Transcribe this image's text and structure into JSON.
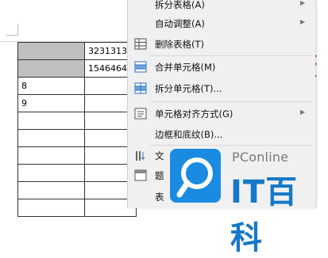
{
  "document": {
    "table_rows": [
      [
        "",
        "3231313"
      ],
      [
        "",
        "1546464"
      ],
      [
        "8",
        ""
      ],
      [
        "9",
        ""
      ],
      [
        "",
        ""
      ],
      [
        "",
        ""
      ],
      [
        "",
        ""
      ],
      [
        "",
        ""
      ],
      [
        "",
        ""
      ],
      [
        "",
        ""
      ]
    ]
  },
  "context_menu": {
    "items": [
      {
        "label": "拆分表格(A)",
        "icon": "none",
        "has_submenu": true
      },
      {
        "label": "自动调整(A)",
        "icon": "none",
        "has_submenu": true
      },
      {
        "label": "删除表格(T)",
        "icon": "delete-table-icon",
        "has_submenu": false
      },
      {
        "label": "合并单元格(M)",
        "icon": "merge-cells-icon",
        "has_submenu": false
      },
      {
        "label": "拆分单元格(T)...",
        "icon": "split-cells-icon",
        "has_submenu": false
      },
      {
        "label": "单元格对齐方式(G)",
        "icon": "cell-align-icon",
        "has_submenu": true
      },
      {
        "label": "边框和底纹(B)...",
        "icon": "none",
        "has_submenu": false
      },
      {
        "label": "文",
        "icon": "text-direction-icon",
        "has_submenu": false
      },
      {
        "label": "题",
        "icon": "title-row-icon",
        "has_submenu": false
      },
      {
        "label": "表",
        "icon": "table-properties-icon",
        "has_submenu": false
      }
    ]
  },
  "watermark": {
    "brand_en": "PConline",
    "brand_cn": "IT百科",
    "color": "#1a8be0"
  },
  "colors": {
    "shaded_cell": "#bfbfbf",
    "menu_bg": "#f0f0f0",
    "icon_blue": "#2a6fc0",
    "annotation_red": "#cc1111"
  }
}
